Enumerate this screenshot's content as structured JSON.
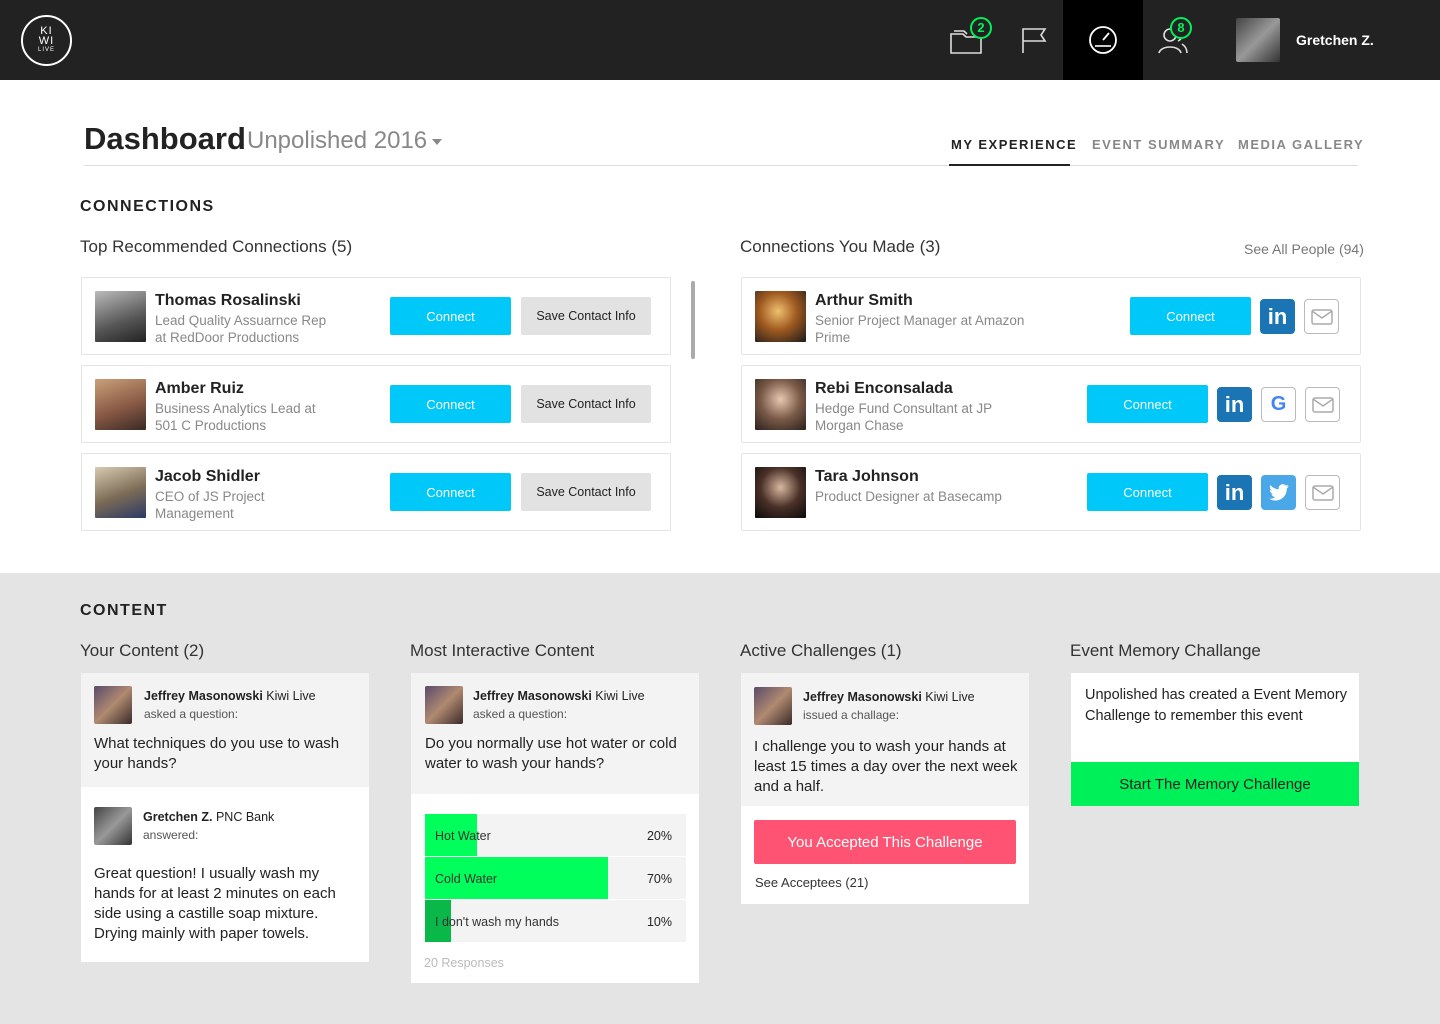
{
  "app": {
    "logo_line1": "KI",
    "logo_line2": "WI",
    "logo_line3": "LIVE"
  },
  "nav": {
    "folder_badge": "2",
    "people_badge": "8",
    "user_name": "Gretchen Z."
  },
  "header": {
    "title": "Dashboard",
    "event": "Unpolished 2016",
    "tabs": [
      {
        "label": "MY EXPERIENCE",
        "active": true
      },
      {
        "label": "EVENT SUMMARY",
        "active": false
      },
      {
        "label": "MEDIA GALLERY",
        "active": false
      }
    ]
  },
  "connections": {
    "section_title": "CONNECTIONS",
    "recommended_title": "Top Recommended Connections (5)",
    "made_title": "Connections You Made (3)",
    "see_all": "See All People (94)",
    "recommended": [
      {
        "name": "Thomas Rosalinski",
        "desc1": "Lead Quality Assuarnce Rep",
        "desc2": "at RedDoor Productions",
        "connect": "Connect",
        "save": "Save Contact Info"
      },
      {
        "name": "Amber Ruiz",
        "desc1": "Business Analytics Lead at",
        "desc2": "501 C Productions",
        "connect": "Connect",
        "save": "Save Contact Info"
      },
      {
        "name": "Jacob Shidler",
        "desc1": "CEO of JS Project",
        "desc2": "Management",
        "connect": "Connect",
        "save": "Save Contact Info"
      }
    ],
    "made": [
      {
        "name": "Arthur Smith",
        "desc1": "Senior Project Manager at Amazon",
        "desc2": "Prime",
        "connect": "Connect"
      },
      {
        "name": "Rebi Enconsalada",
        "desc1": "Hedge Fund Consultant at JP",
        "desc2": "Morgan Chase",
        "connect": "Connect"
      },
      {
        "name": "Tara Johnson",
        "desc1": "Product Designer at Basecamp",
        "desc2": "",
        "connect": "Connect"
      }
    ]
  },
  "content": {
    "section_title": "CONTENT",
    "your_content": {
      "title": "Your Content (2)",
      "author": "Jeffrey Masonowski",
      "org": "Kiwi Live",
      "verb": "asked a question:",
      "question": "What techniques do you use to wash your hands?",
      "answer_author": "Gretchen Z.",
      "answer_org": "PNC Bank",
      "answer_verb": "answered:",
      "answer": "Great question! I usually wash my hands for at least 2 minutes on each side using a castille soap mixture. Drying mainly with paper towels."
    },
    "interactive": {
      "title": "Most Interactive Content",
      "author": "Jeffrey Masonowski",
      "org": "Kiwi Live",
      "verb": "asked a question:",
      "question": "Do you normally use hot water or cold water to wash your hands?",
      "poll": [
        {
          "label": "Hot Water",
          "pct": "20%",
          "value": 0.2
        },
        {
          "label": "Cold Water",
          "pct": "70%",
          "value": 0.7
        },
        {
          "label": "I don't wash my hands",
          "pct": "10%",
          "value": 0.1
        }
      ],
      "responses": "20 Responses"
    },
    "challenges": {
      "title": "Active Challenges (1)",
      "author": "Jeffrey Masonowski",
      "org": "Kiwi Live",
      "verb": "issued a challage:",
      "text": "I challenge you to wash your hands at least 15 times a day over the next week and a half.",
      "accepted": "You Accepted This Challenge",
      "acceptees": "See Acceptees (21)"
    },
    "memory": {
      "title": "Event Memory Challange",
      "text": "Unpolished has created a Event Memory Challenge to remember this event",
      "button": "Start The Memory Challenge"
    }
  },
  "colors": {
    "connect": "#00c8f8",
    "accent_green": "#00f05a",
    "accepted": "#ff5373",
    "linkedin": "#1b74b3",
    "twitter": "#4aa8e8",
    "topbar": "#222222"
  }
}
